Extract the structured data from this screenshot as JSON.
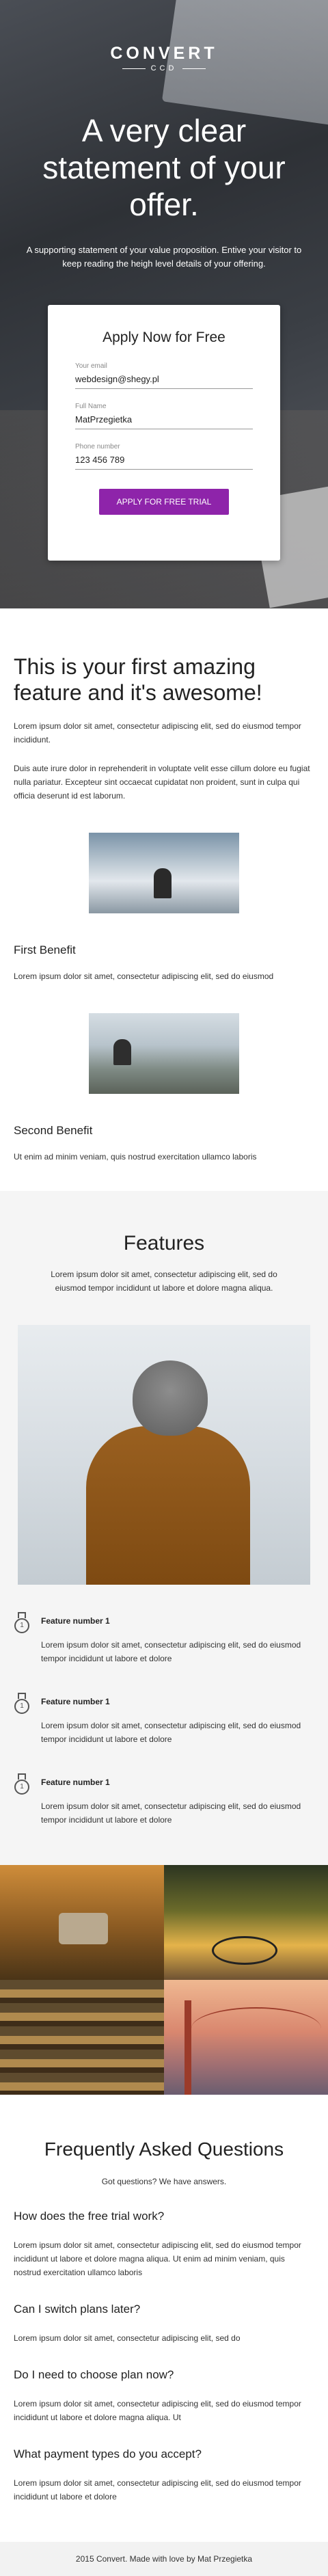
{
  "hero": {
    "logo_main": "CONVERT",
    "logo_sub": "CCD",
    "title": "A very clear statement of your offer.",
    "subtitle": "A supporting statement of your value proposition. Entive your visitor to keep reading the heigh level details of your offering.",
    "form": {
      "title": "Apply Now for Free",
      "fields": [
        {
          "label": "Your email",
          "value": "webdesign@shegy.pl"
        },
        {
          "label": "Full Name",
          "value": "MatPrzegietka"
        },
        {
          "label": "Phone number",
          "value": "123 456 789"
        }
      ],
      "cta": "APPLY FOR FREE TRIAL"
    }
  },
  "feature1": {
    "title": "This is your first amazing feature and it's awesome!",
    "text1": "Lorem ipsum dolor sit amet, consectetur adipiscing elit, sed do eiusmod tempor incididunt.",
    "text2": "Duis aute irure dolor in reprehenderit in voluptate velit esse cillum dolore eu fugiat nulla pariatur. Excepteur sint occaecat cupidatat non proident, sunt in culpa qui officia deserunt id est laborum.",
    "benefits": [
      {
        "title": "First Benefit",
        "text": "Lorem ipsum dolor sit amet, consectetur adipiscing elit, sed do eiusmod"
      },
      {
        "title": "Second Benefit",
        "text": "Ut enim ad minim veniam, quis nostrud exercitation ullamco laboris"
      }
    ]
  },
  "features": {
    "title": "Features",
    "subtitle": "Lorem ipsum dolor sit amet, consectetur adipiscing elit, sed do eiusmod tempor incididunt ut labore et dolore magna aliqua.",
    "icon": "medal-icon",
    "medal_numeral": "1",
    "items": [
      {
        "title": "Feature number 1",
        "text": "Lorem ipsum dolor sit amet, consectetur adipiscing elit, sed do eiusmod tempor incididunt ut labore et dolore"
      },
      {
        "title": "Feature number 1",
        "text": "Lorem ipsum dolor sit amet, consectetur adipiscing elit, sed do eiusmod tempor incididunt ut labore et dolore"
      },
      {
        "title": "Feature number 1",
        "text": "Lorem ipsum dolor sit amet, consectetur adipiscing elit, sed do eiusmod tempor incididunt ut labore et dolore"
      }
    ]
  },
  "faq": {
    "title": "Frequently Asked Questions",
    "subtitle": "Got questions? We have answers.",
    "items": [
      {
        "q": "How does the free trial work?",
        "a": "Lorem ipsum dolor sit amet, consectetur adipiscing elit, sed do eiusmod tempor incididunt ut labore et dolore magna aliqua. Ut enim ad minim veniam, quis nostrud exercitation ullamco laboris"
      },
      {
        "q": "Can I switch plans later?",
        "a": "Lorem ipsum dolor sit amet, consectetur adipiscing elit, sed do"
      },
      {
        "q": "Do I need to choose plan now?",
        "a": "Lorem ipsum dolor sit amet, consectetur adipiscing elit, sed do eiusmod tempor incididunt ut labore et dolore magna aliqua. Ut"
      },
      {
        "q": "What payment types do you accept?",
        "a": "Lorem ipsum dolor sit amet, consectetur adipiscing elit, sed do eiusmod tempor incididunt ut labore et dolore"
      }
    ]
  },
  "footer": {
    "text": "2015 Convert. Made with love by Mat Przegietka"
  },
  "colors": {
    "accent": "#8e24aa",
    "section_bg": "#f5f5f5"
  }
}
